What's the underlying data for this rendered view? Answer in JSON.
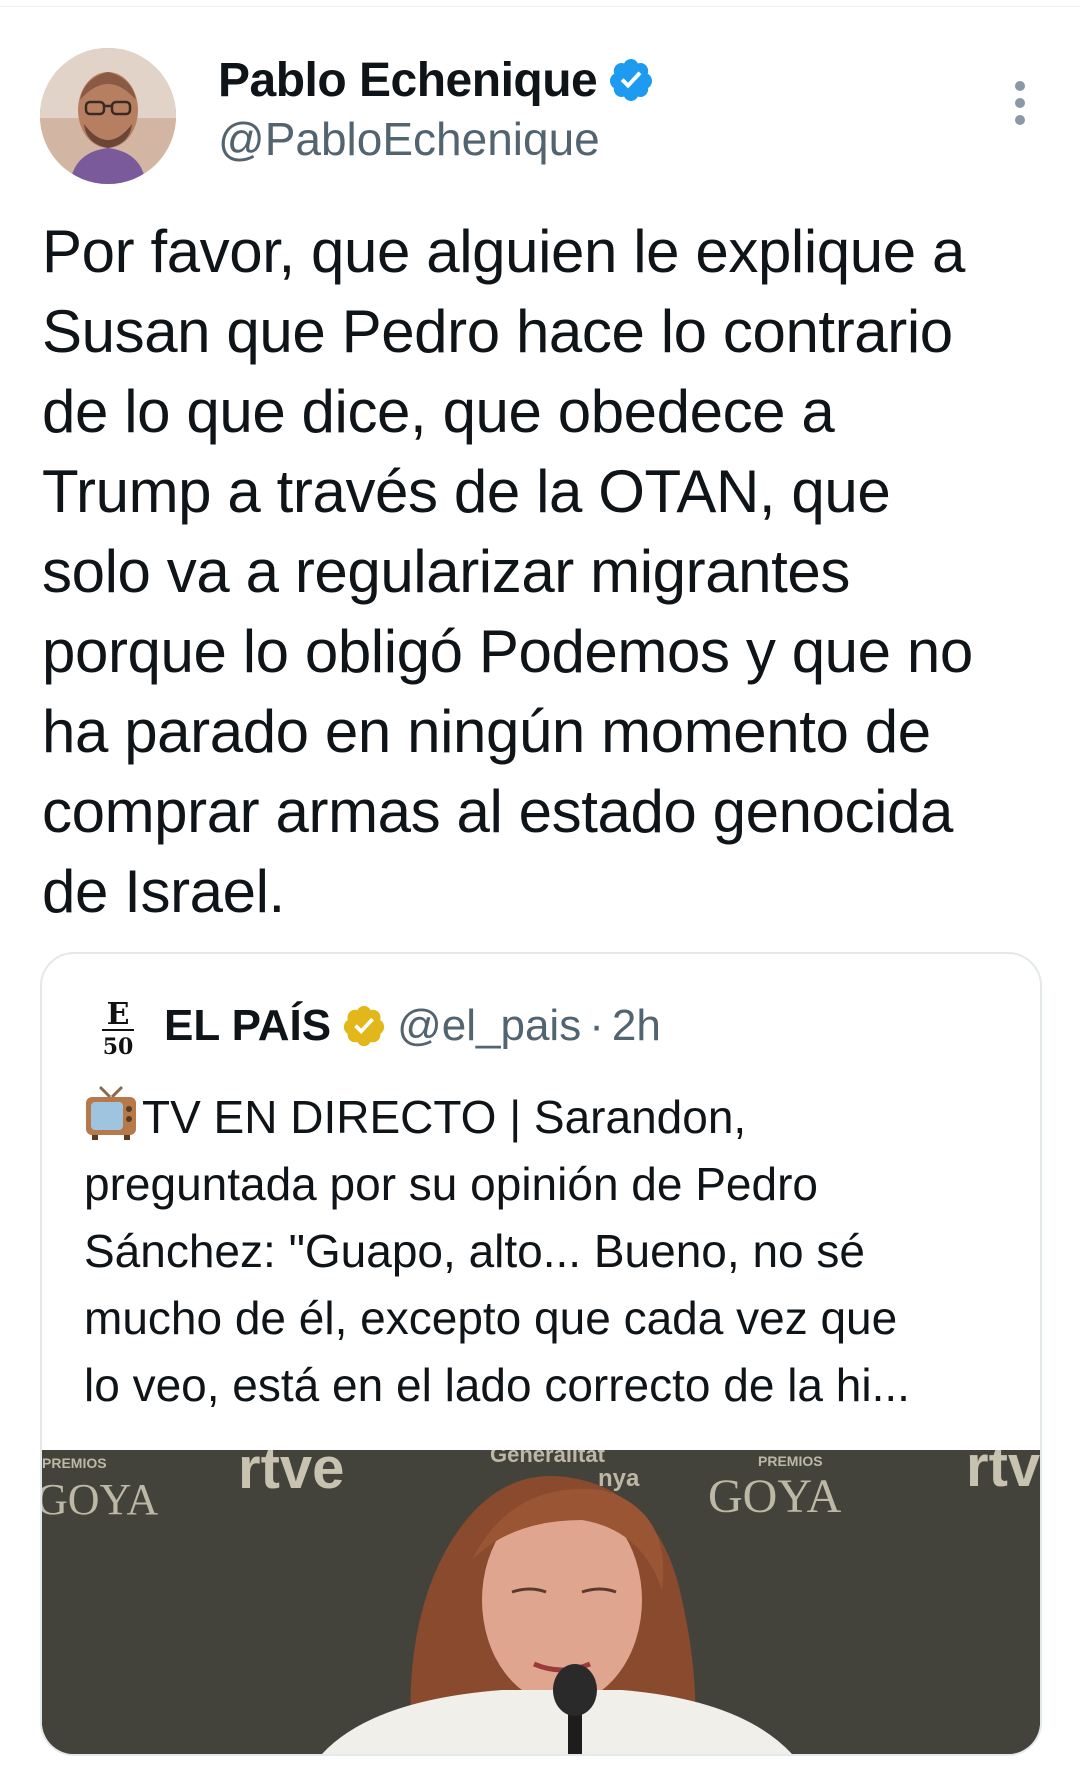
{
  "tweet": {
    "author": {
      "display_name": "Pablo Echenique",
      "handle": "@PabloEchenique",
      "verified_icon": "verified-badge-blue"
    },
    "more_icon": "more-vertical-icon",
    "text_lines": [
      "Por favor, que alguien le explique a",
      "Susan que Pedro hace lo contrario",
      "de lo que dice, que obedece a",
      "Trump a través de la OTAN, que",
      "solo va a regularizar migrantes",
      "porque lo obligó Podemos y que no",
      "ha parado en ningún momento de",
      "comprar armas al estado genocida",
      "de Israel."
    ]
  },
  "quote": {
    "logo_text": "E50",
    "display_name": "EL PAÍS",
    "verified_icon": "verified-badge-gold",
    "handle": "@el_pais",
    "separator": "·",
    "time": "2h",
    "text_lines": [
      "TV EN DIRECTO | Sarandon,",
      "preguntada por su opinión de Pedro",
      "Sánchez: \"Guapo, alto... Bueno, no sé",
      "mucho de él, excepto que cada vez que",
      "lo veo, está en el lado correcto de la hi..."
    ],
    "media": {
      "backdrop_texts": [
        "PREMIOS",
        "GOYA",
        "rtve",
        "Generalitat",
        "nya",
        "PREMIOS",
        "GOYA",
        "rtv"
      ]
    }
  },
  "colors": {
    "text": "#0f1419",
    "secondary": "#536471",
    "verified_blue": "#1d9bf0",
    "verified_gold": "#e2b719",
    "border": "#e3e8ea"
  }
}
